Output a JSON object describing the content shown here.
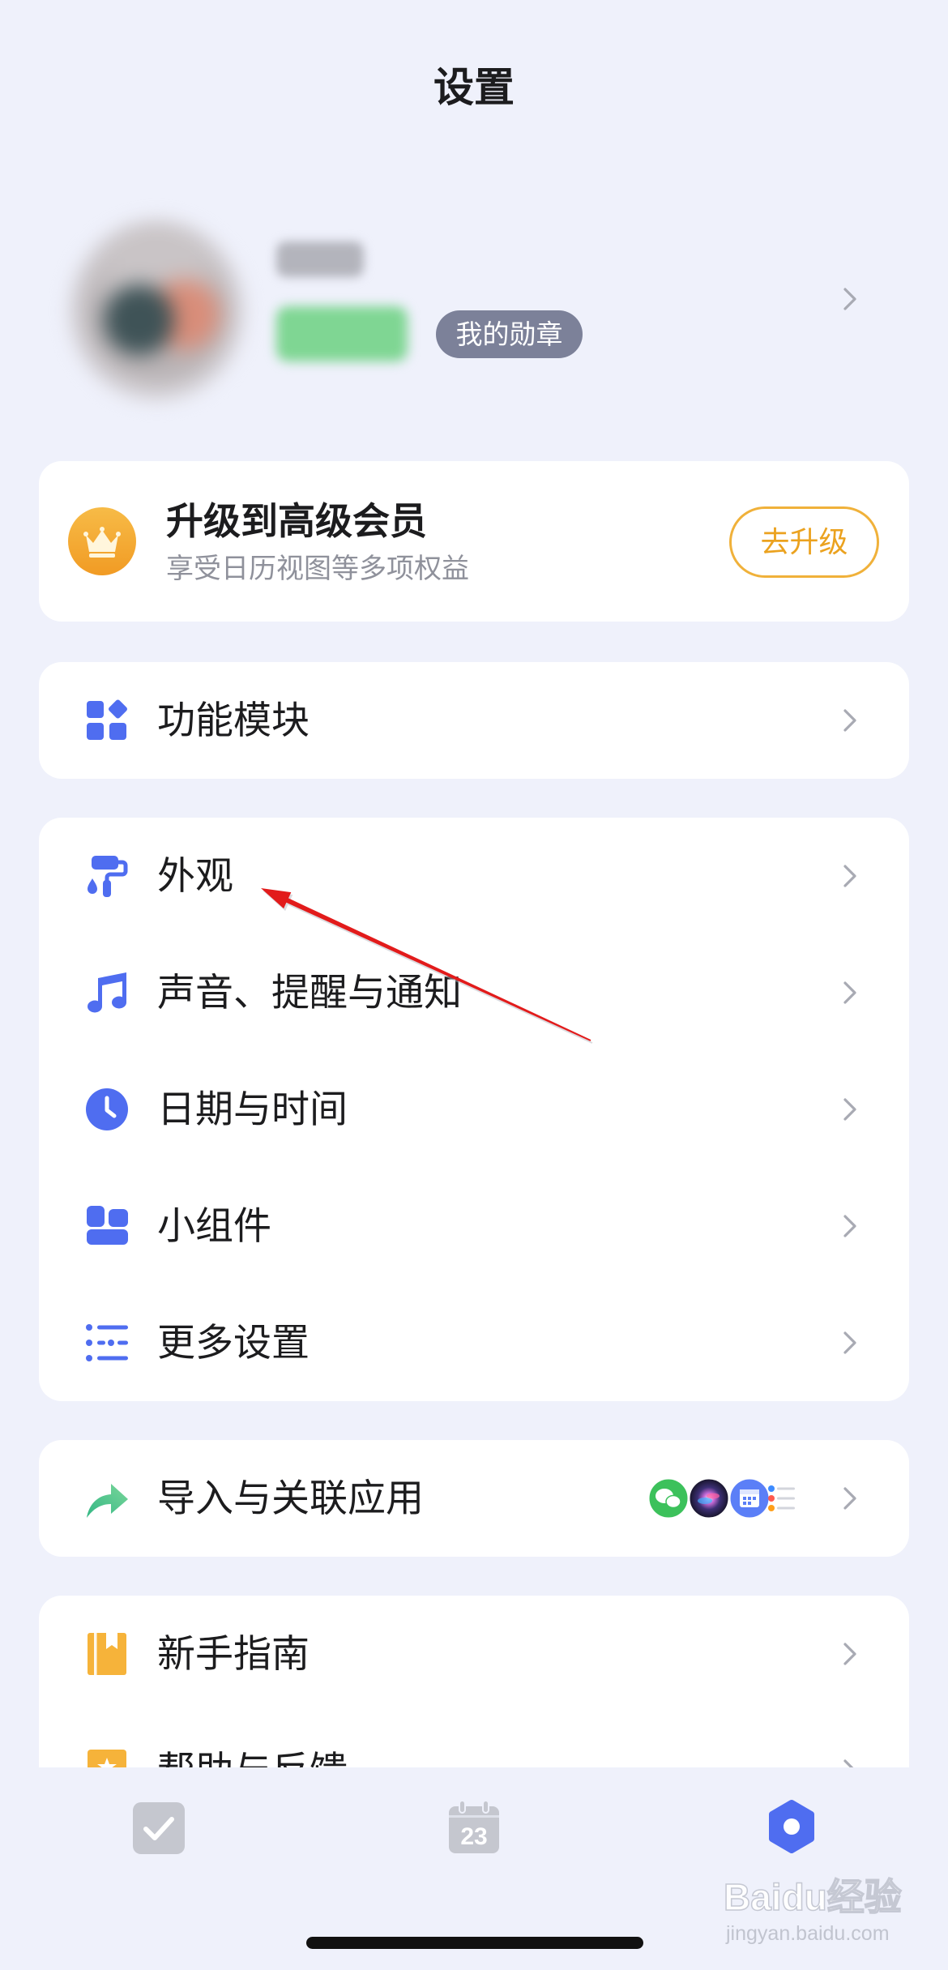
{
  "header": {
    "title": "设置"
  },
  "profile": {
    "medal_label": "我的勋章"
  },
  "upgrade": {
    "icon": "crown-icon",
    "title": "升级到高级会员",
    "subtitle": "享受日历视图等多项权益",
    "button_label": "去升级"
  },
  "sections": [
    {
      "rows": [
        {
          "label": "功能模块",
          "icon": "grid-icon"
        }
      ]
    },
    {
      "rows": [
        {
          "label": "外观",
          "icon": "paint-roller-icon"
        },
        {
          "label": "声音、提醒与通知",
          "icon": "music-note-icon"
        },
        {
          "label": "日期与时间",
          "icon": "clock-icon"
        },
        {
          "label": "小组件",
          "icon": "widgets-icon"
        },
        {
          "label": "更多设置",
          "icon": "list-icon"
        }
      ]
    },
    {
      "rows": [
        {
          "label": "导入与关联应用",
          "icon": "share-arrow-icon",
          "linked_apps": [
            "wechat-icon",
            "siri-icon",
            "calendar-app-icon",
            "reminders-icon"
          ]
        }
      ]
    },
    {
      "rows": [
        {
          "label": "新手指南",
          "icon": "book-icon"
        },
        {
          "label": "帮助与反馈",
          "icon": "help-star-icon"
        }
      ]
    }
  ],
  "tabbar": {
    "items": [
      {
        "icon": "checkbox-icon",
        "active": false
      },
      {
        "icon": "calendar-icon",
        "date": "23",
        "active": false
      },
      {
        "icon": "settings-hexagon-icon",
        "active": true
      }
    ]
  },
  "watermark": {
    "brand": "Baidu经验",
    "url": "jingyan.baidu.com"
  },
  "colors": {
    "background": "#eff1fb",
    "card": "#ffffff",
    "accent_blue": "#4f6df0",
    "upgrade_orange": "#f0b13a",
    "medal_badge": "#7c8199",
    "guide_orange": "#f6b33a",
    "tab_inactive": "#c5c7cf"
  }
}
